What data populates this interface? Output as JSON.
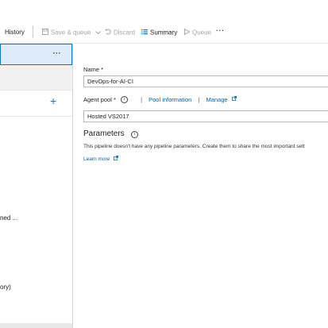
{
  "toolbar": {
    "history_label": "History",
    "save_queue_label": "Save & queue",
    "discard_label": "Discard",
    "summary_label": "Summary",
    "queue_label": "Queue",
    "more_label": "···"
  },
  "left_panel": {
    "more_label": "···",
    "add_label": "+",
    "item1_label": "ned ...",
    "item2_label": "ory)"
  },
  "form": {
    "name_label": "Name *",
    "name_value": "DevOps-for-AI-CI",
    "agent_pool_label": "Agent pool *",
    "pool_information_link": "Pool information",
    "manage_link": "Manage",
    "agent_pool_value": "Hosted VS2017",
    "parameters_title": "Parameters",
    "parameters_description": "This pipeline doesn't have any pipeline parameters. Create them to share the most important sett",
    "learn_more_link": "Learn more"
  },
  "colors": {
    "accent": "#0078d4",
    "selected_bg": "#deecf9",
    "link": "#0062ad",
    "disabled_text": "#a6a6a6"
  },
  "icons": [
    "save-icon",
    "chevron-down-icon",
    "undo-icon",
    "summary-list-icon",
    "play-icon",
    "info-icon",
    "external-link-icon",
    "plus-icon"
  ]
}
